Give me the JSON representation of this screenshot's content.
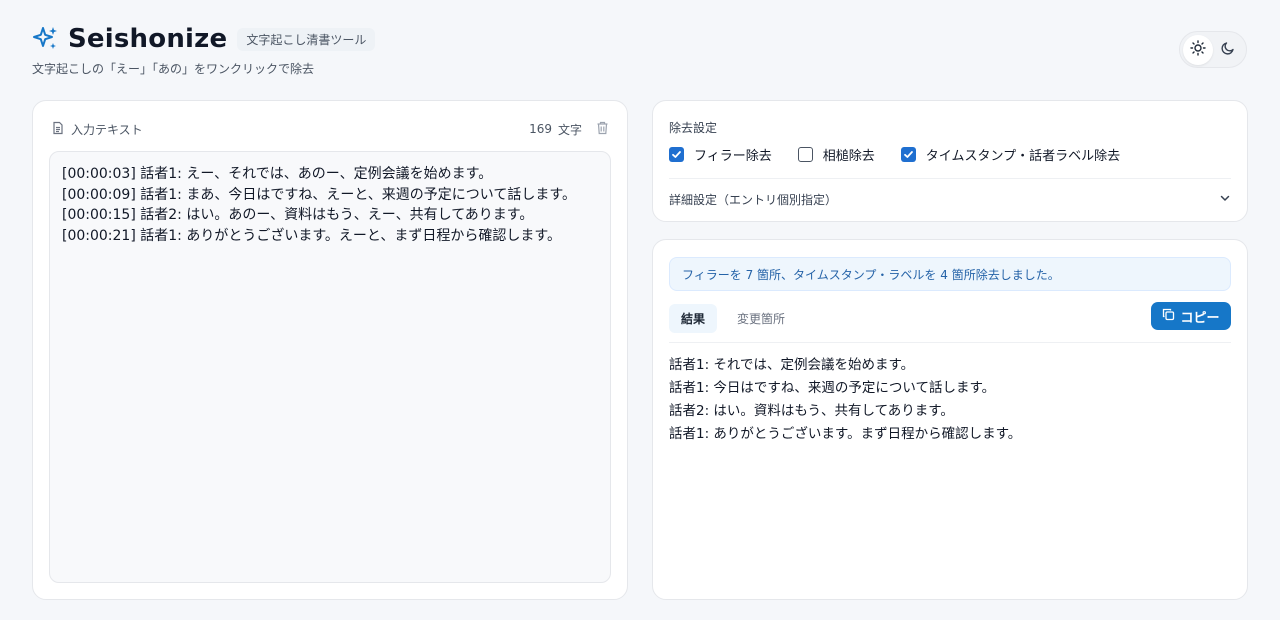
{
  "header": {
    "title": "Seishonize",
    "tag": "文字起こし清書ツール",
    "subtitle": "文字起こしの「えー」「あの」をワンクリックで除去"
  },
  "theme": {
    "light_icon": "sun-icon",
    "dark_icon": "moon-icon",
    "active": "light"
  },
  "input": {
    "label": "入力テキスト",
    "char_count": "169",
    "char_unit": "文字",
    "text": "[00:00:03] 話者1: えー、それでは、あのー、定例会議を始めます。\n[00:00:09] 話者1: まあ、今日はですね、えーと、来週の予定について話します。\n[00:00:15] 話者2: はい。あのー、資料はもう、えー、共有してあります。\n[00:00:21] 話者1: ありがとうございます。えーと、まず日程から確認します。"
  },
  "settings": {
    "title": "除去設定",
    "options": [
      {
        "label": "フィラー除去",
        "checked": true
      },
      {
        "label": "相槌除去",
        "checked": false
      },
      {
        "label": "タイムスタンプ・話者ラベル除去",
        "checked": true
      }
    ],
    "detail_label": "詳細設定（エントリ個別指定）"
  },
  "result": {
    "notice": "フィラーを 7 箇所、タイムスタンプ・ラベルを 4 箇所除去しました。",
    "tabs": [
      {
        "label": "結果",
        "active": true
      },
      {
        "label": "変更箇所",
        "active": false
      }
    ],
    "copy_label": "コピー",
    "output": "話者1: それでは、定例会議を始めます。\n話者1: 今日はですね、来週の予定について話します。\n話者2: はい。資料はもう、共有してあります。\n話者1: ありがとうございます。まず日程から確認します。"
  },
  "colors": {
    "accent": "#1677c8",
    "checkbox": "#1f6fd0",
    "notice_text": "#2563a8"
  }
}
